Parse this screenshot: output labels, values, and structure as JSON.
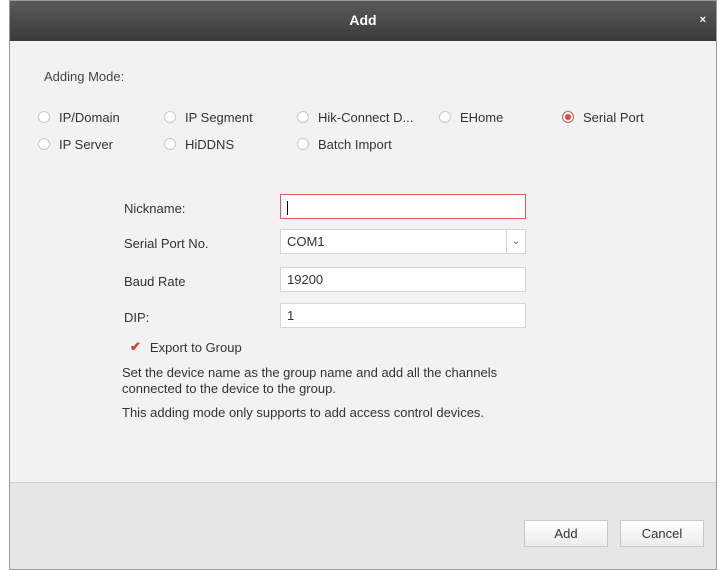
{
  "dialog": {
    "title": "Add",
    "close_symbol": "×"
  },
  "adding_mode": {
    "label": "Adding Mode:",
    "options": [
      {
        "label": "IP/Domain",
        "checked": false
      },
      {
        "label": "IP Segment",
        "checked": false
      },
      {
        "label": "Hik-Connect D...",
        "checked": false
      },
      {
        "label": "EHome",
        "checked": false
      },
      {
        "label": "Serial Port",
        "checked": true
      },
      {
        "label": "IP Server",
        "checked": false
      },
      {
        "label": "HiDDNS",
        "checked": false
      },
      {
        "label": "Batch Import",
        "checked": false
      }
    ]
  },
  "form": {
    "nickname_label": "Nickname:",
    "nickname_value": "",
    "serial_port_label": "Serial Port No.",
    "serial_port_value": "COM1",
    "baud_rate_label": "Baud Rate",
    "baud_rate_value": "19200",
    "dip_label": "DIP:",
    "dip_value": "1",
    "export_label": "Export to Group",
    "export_checked": true
  },
  "description": {
    "line1": "Set the device name as the group name and add all the channels connected to the device to the group.",
    "line2": "This adding mode only supports to add access control devices."
  },
  "buttons": {
    "add": "Add",
    "cancel": "Cancel"
  },
  "colors": {
    "title_bar": "#444444",
    "accent_red": "#e0443a"
  }
}
